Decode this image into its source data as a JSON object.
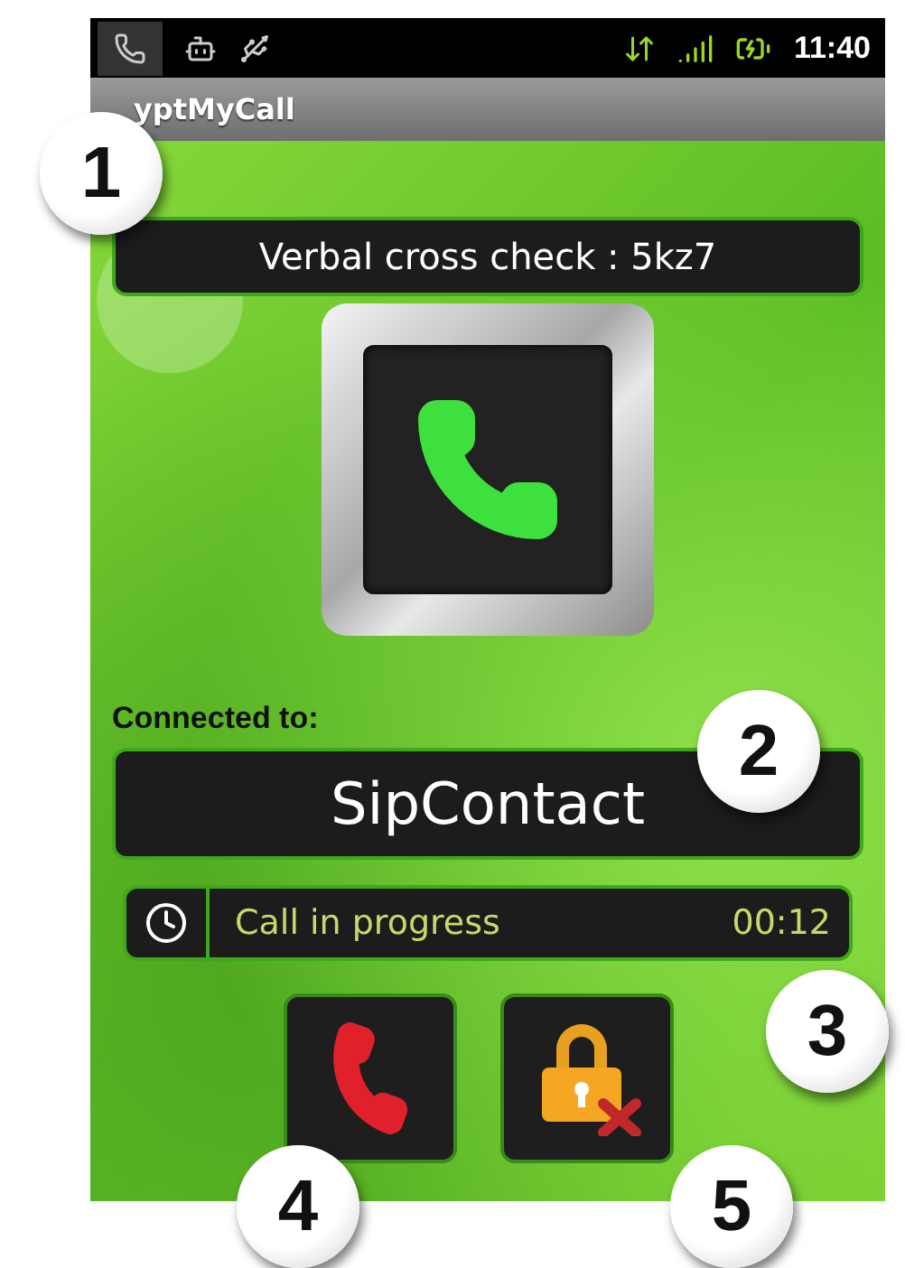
{
  "status_bar": {
    "time": "11:40"
  },
  "app_bar": {
    "title": "yptMyCall"
  },
  "verification": {
    "label": "Verbal cross check : 5kz7"
  },
  "connection": {
    "label": "Connected to:",
    "contact": "SipContact"
  },
  "call_status": {
    "text": "Call in progress",
    "duration": "00:12"
  },
  "callouts": [
    "1",
    "2",
    "3",
    "4",
    "5"
  ]
}
